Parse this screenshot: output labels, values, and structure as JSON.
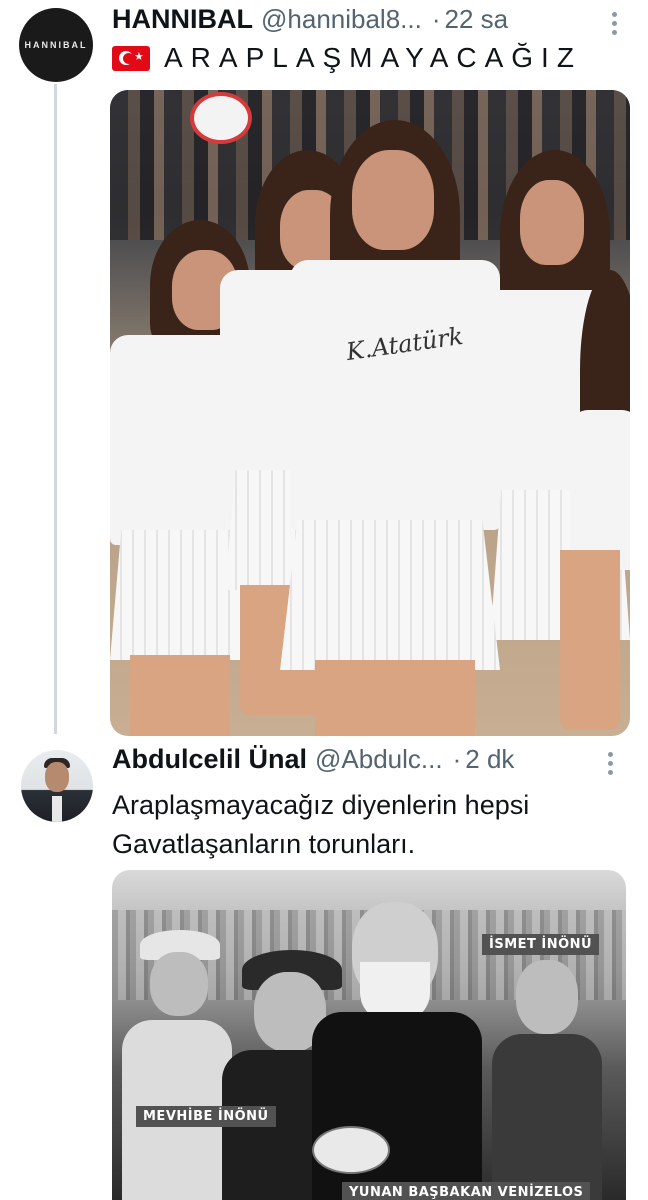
{
  "tweets": [
    {
      "display_name": "HANNIBAL",
      "handle": "@hannibal8...",
      "separator": "·",
      "time": "22 sa",
      "avatar_text": "HANNIBAL",
      "flag_icon": "turkey-flag-icon",
      "text": "ARAPLAŞMAYACAĞIZ",
      "media_description_signature": "K.Atatürk"
    },
    {
      "display_name": "Abdulcelil Ünal",
      "handle": "@Abdulc...",
      "separator": "·",
      "time": "2 dk",
      "text_lines": [
        "Araplaşmayacağız diyenlerin hepsi",
        "Gavatlaşanların torunları."
      ],
      "media_labels": {
        "ismet": "İSMET İNÖNÜ",
        "mevhibe": "MEVHİBE İNÖNÜ",
        "yunan": "YUNAN BAŞBAKAN VENİZELOS"
      }
    }
  ],
  "colors": {
    "text_primary": "#0f1419",
    "text_secondary": "#536471",
    "thread_line": "#cfd9de",
    "label_red": "#d32f2f"
  }
}
